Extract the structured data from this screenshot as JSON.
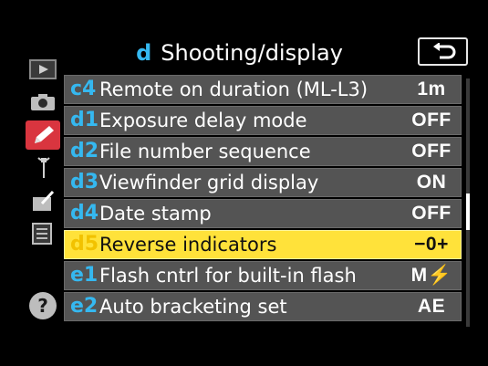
{
  "header": {
    "menu_letter": "d",
    "title": "Shooting/display",
    "back_icon": "return-arrow-icon"
  },
  "sidebar": {
    "items": [
      {
        "name": "playback",
        "icon": "play-icon"
      },
      {
        "name": "shooting",
        "icon": "camera-icon"
      },
      {
        "name": "custom-settings",
        "icon": "pencil-icon",
        "active": true
      },
      {
        "name": "setup",
        "icon": "wrench-icon"
      },
      {
        "name": "retouch",
        "icon": "retouch-icon"
      },
      {
        "name": "my-menu",
        "icon": "list-icon"
      }
    ],
    "help_label": "?"
  },
  "menu": {
    "items": [
      {
        "code": "c4",
        "label": "Remote on duration (ML-L3)",
        "value": "1m"
      },
      {
        "code": "d1",
        "label": "Exposure delay mode",
        "value": "OFF"
      },
      {
        "code": "d2",
        "label": "File number sequence",
        "value": "OFF"
      },
      {
        "code": "d3",
        "label": "Viewfinder grid display",
        "value": "ON"
      },
      {
        "code": "d4",
        "label": "Date stamp",
        "value": "OFF"
      },
      {
        "code": "d5",
        "label": "Reverse indicators",
        "value": "−0+"
      },
      {
        "code": "e1",
        "label": "Flash cntrl for built-in flash",
        "value": "M⚡"
      },
      {
        "code": "e2",
        "label": "Auto bracketing set",
        "value": "AE"
      }
    ],
    "selected_index": 5
  },
  "colors": {
    "accent": "#35b8f0",
    "selected_row": "#ffe23a",
    "row": "#545454",
    "active_tab": "#d9353f"
  }
}
